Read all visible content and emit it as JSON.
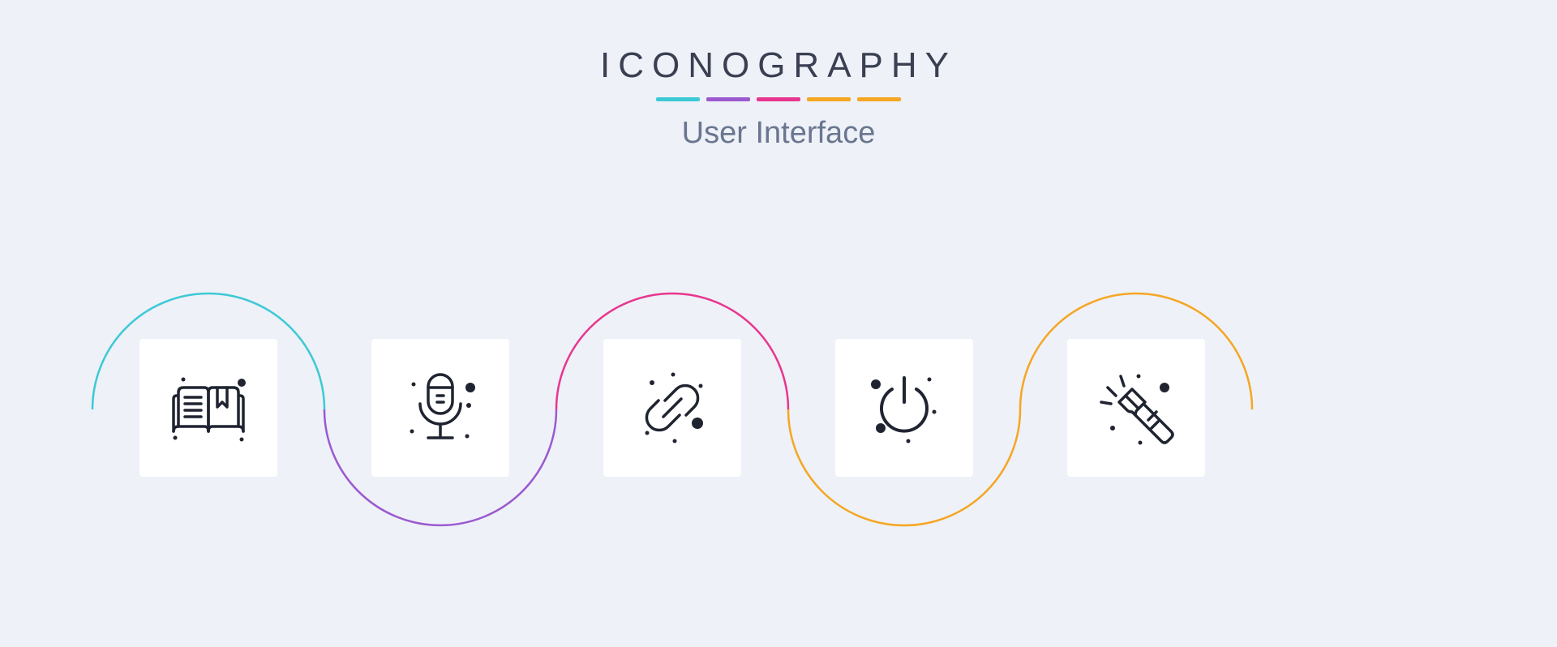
{
  "header": {
    "brand": "ICONOGRAPHY",
    "subtitle": "User Interface",
    "accents": [
      "#3cc9d6",
      "#9b59d0",
      "#e8368f",
      "#f5a623",
      "#f5a623"
    ]
  },
  "wave_colors": [
    "#3cc9d6",
    "#9b59d0",
    "#e8368f",
    "#f5a623",
    "#f5a623"
  ],
  "icons": [
    {
      "name": "book-icon",
      "label": "Book"
    },
    {
      "name": "microphone-icon",
      "label": "Microphone"
    },
    {
      "name": "chain-icon",
      "label": "Chain Link"
    },
    {
      "name": "power-icon",
      "label": "Power"
    },
    {
      "name": "flashlight-icon",
      "label": "Flashlight"
    }
  ]
}
